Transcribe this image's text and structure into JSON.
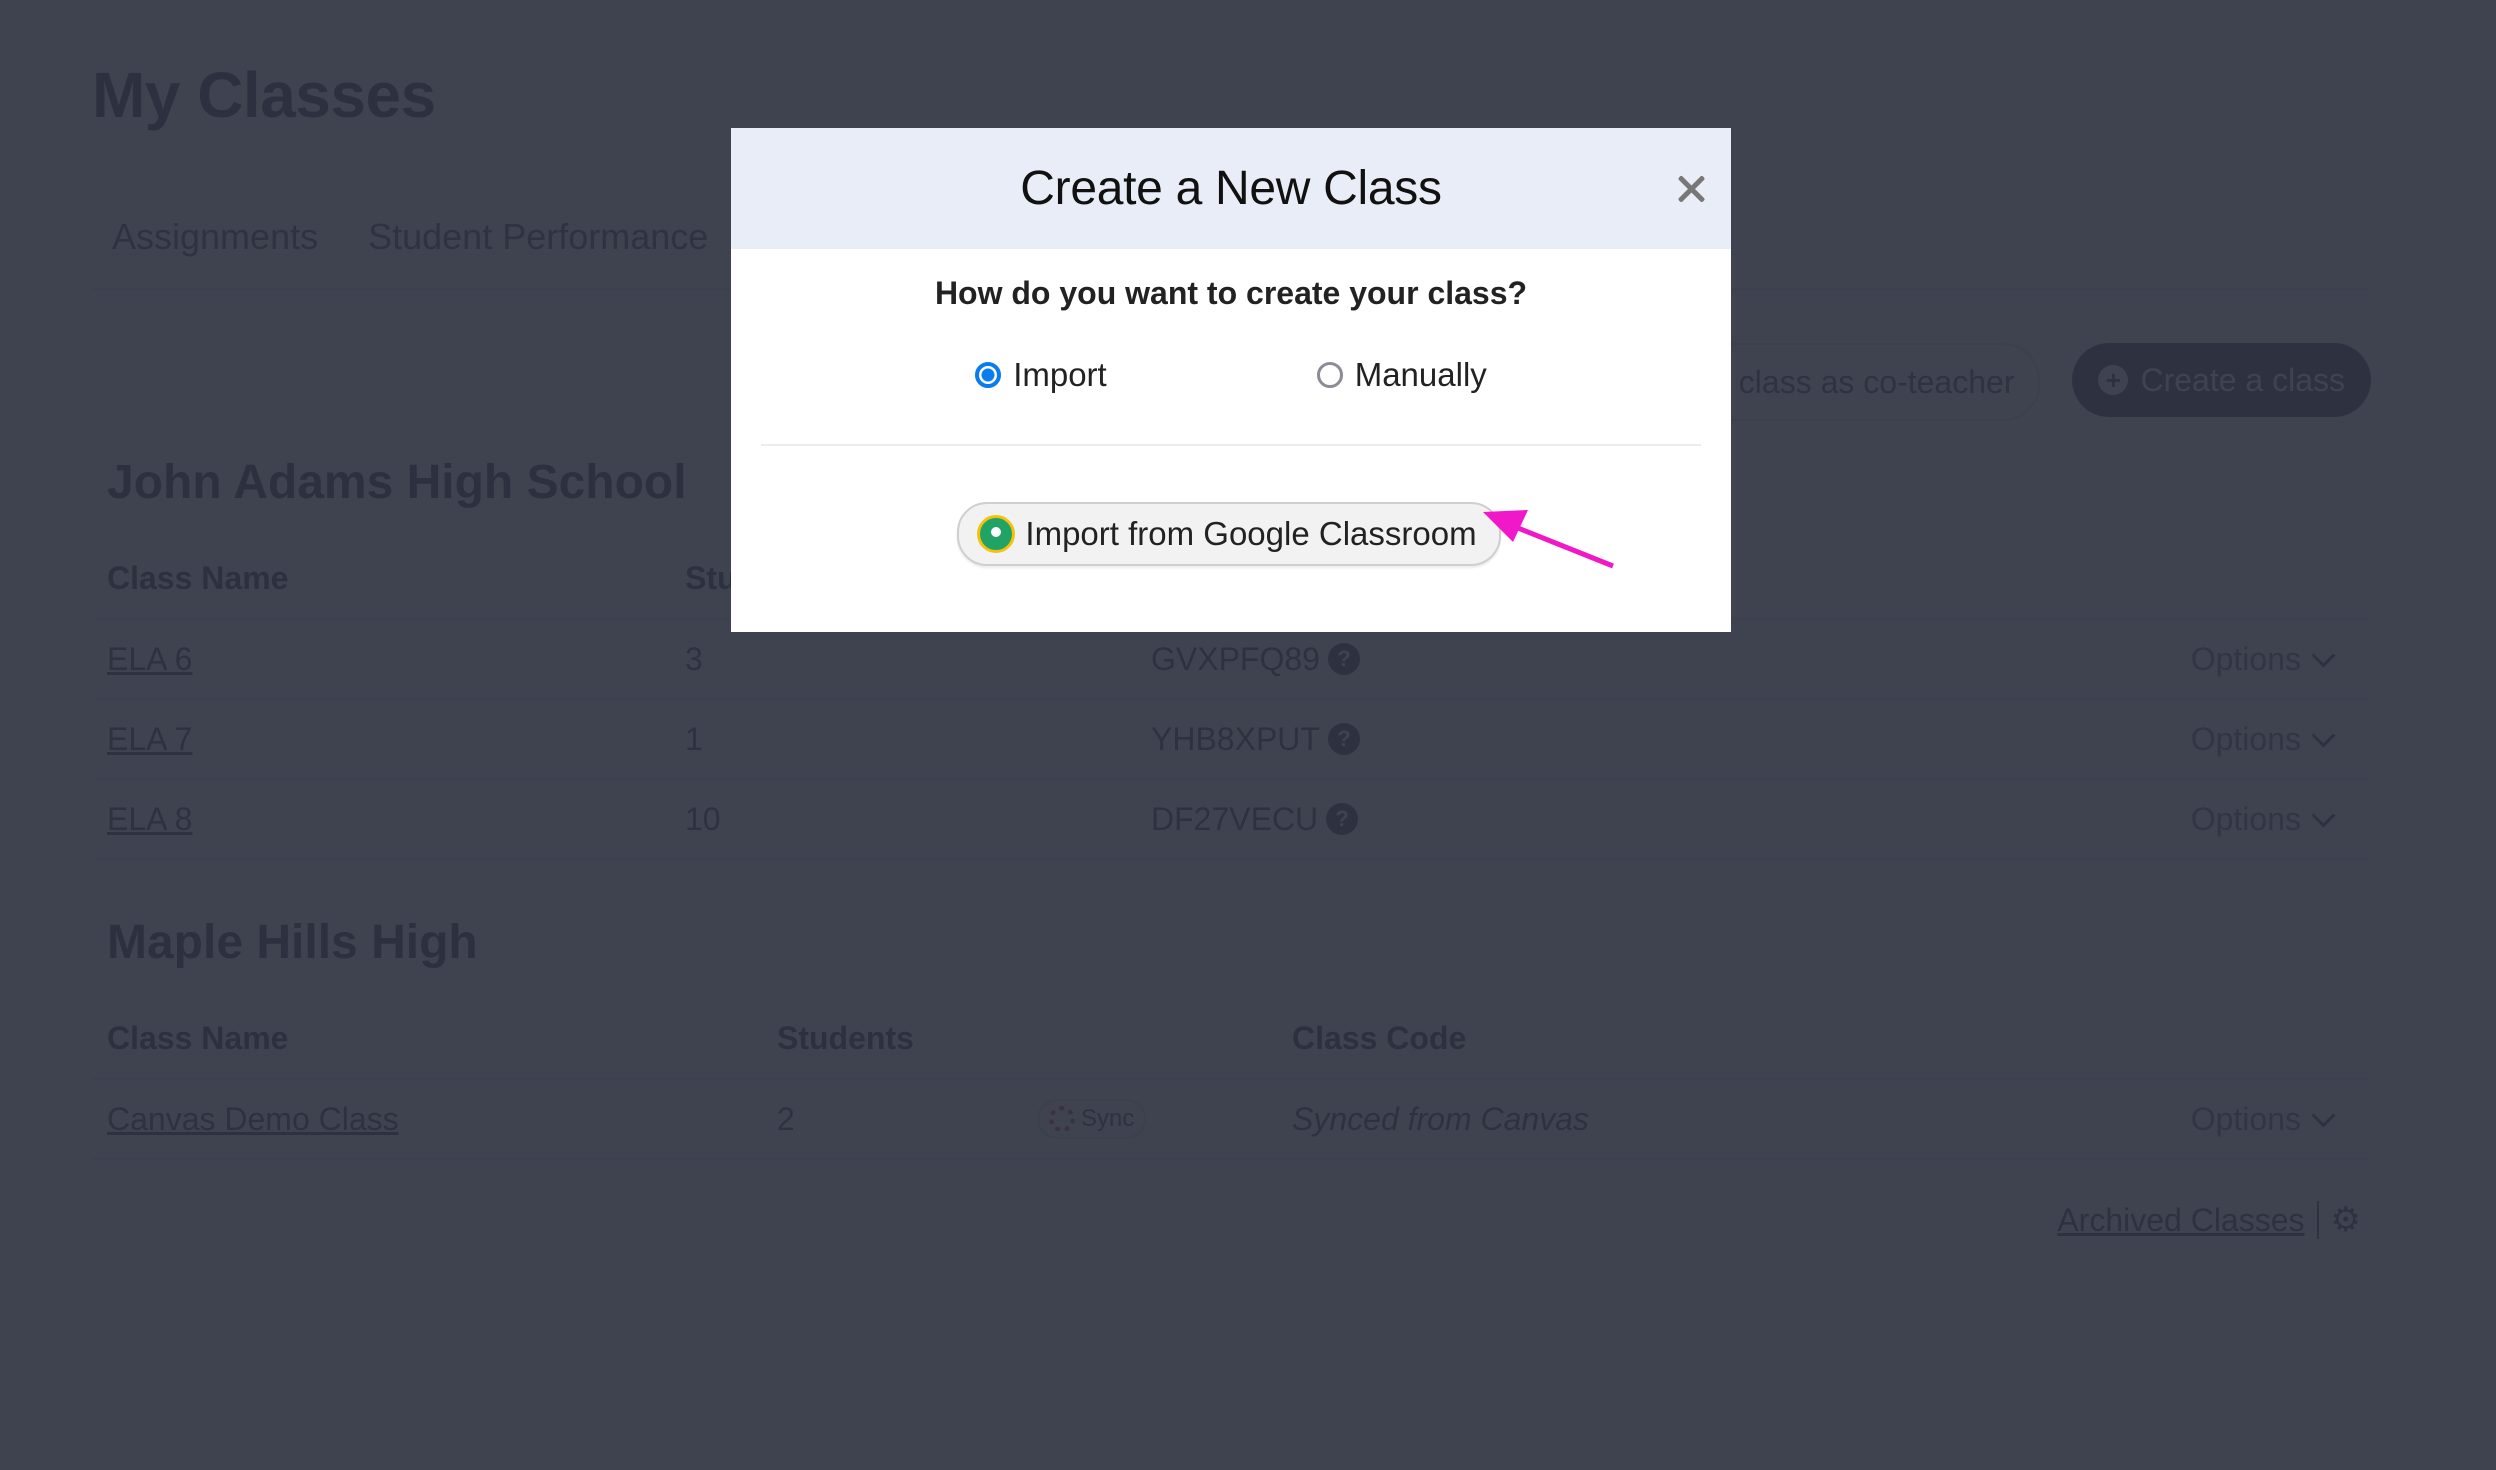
{
  "page": {
    "title": "My Classes",
    "tabs": [
      "Assignments",
      "Student Performance"
    ],
    "actions": {
      "join_coteacher": "Join class as co-teacher",
      "create_class": "Create a class"
    }
  },
  "schools": [
    {
      "name": "John Adams High School",
      "columns": {
        "name": "Class Name",
        "students": "Students",
        "code": "Class Code"
      },
      "rows": [
        {
          "name": "ELA 6",
          "students": "3",
          "code": "GVXPFQ89",
          "options": "Options"
        },
        {
          "name": "ELA 7",
          "students": "1",
          "code": "YHB8XPUT",
          "options": "Options"
        },
        {
          "name": "ELA 8",
          "students": "10",
          "code": "DF27VECU",
          "options": "Options"
        }
      ]
    },
    {
      "name": "Maple Hills High",
      "columns": {
        "name": "Class Name",
        "students": "Students",
        "code": "Class Code"
      },
      "rows": [
        {
          "name": "Canvas Demo Class",
          "students": "2",
          "sync": "Sync",
          "code": "Synced from Canvas",
          "options": "Options"
        }
      ]
    }
  ],
  "archived_link": "Archived Classes",
  "modal": {
    "title": "Create a New Class",
    "question": "How do you want to create your class?",
    "options": [
      {
        "label": "Import",
        "selected": true
      },
      {
        "label": "Manually",
        "selected": false
      }
    ],
    "import_button": "Import from Google Classroom"
  },
  "colors": {
    "accent_blue": "#0a7cf0",
    "annotation_arrow": "#f018c8",
    "google_green": "#21a366"
  }
}
